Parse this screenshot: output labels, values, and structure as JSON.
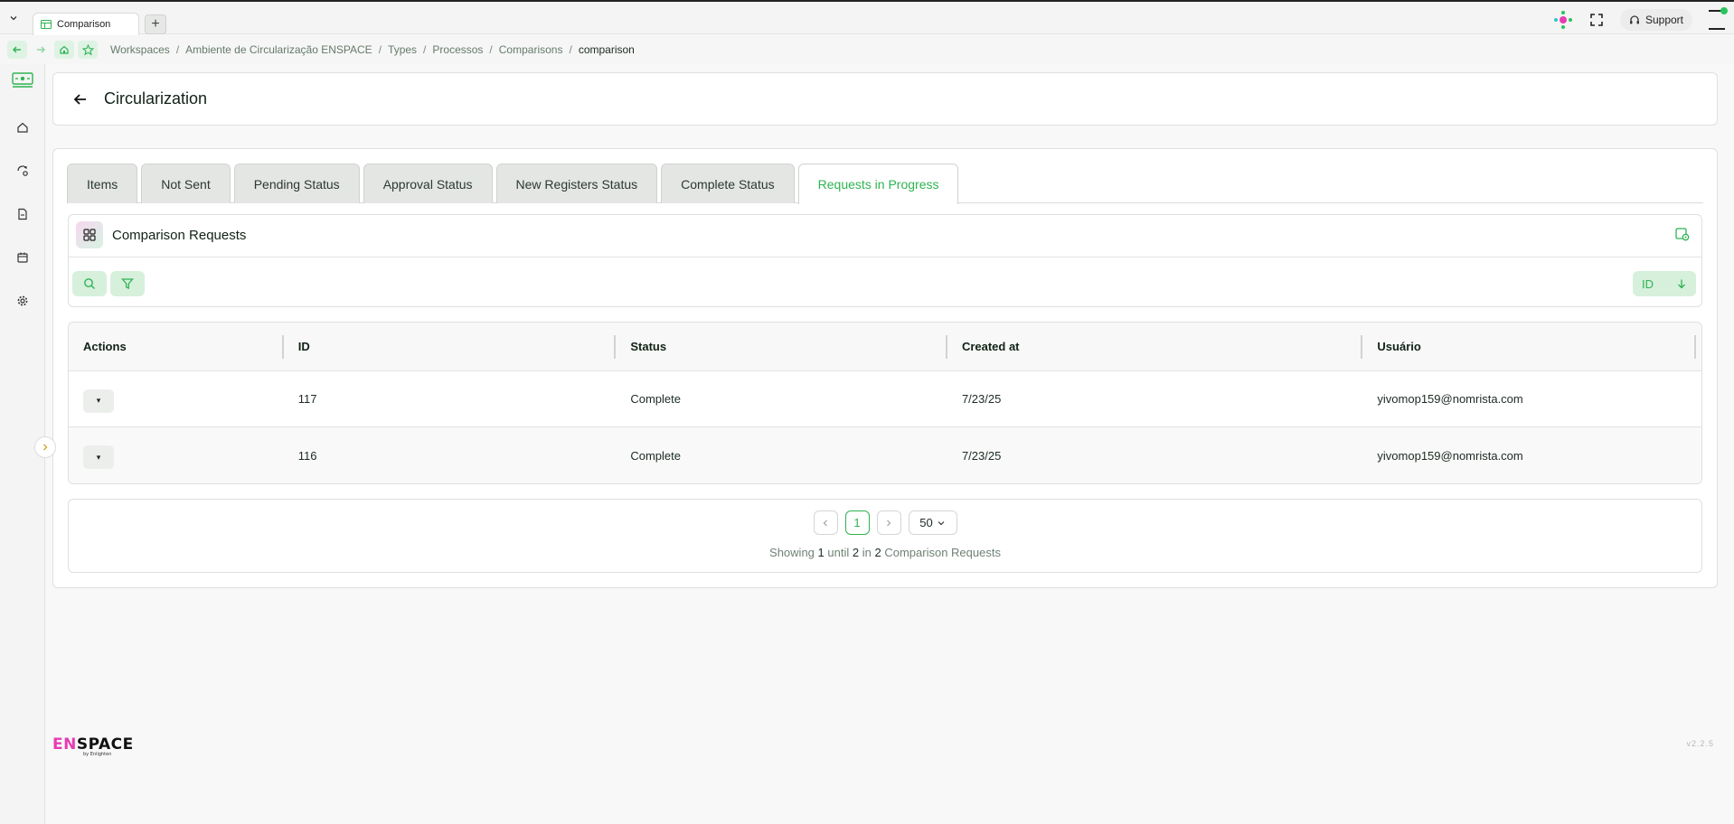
{
  "browser": {
    "tab_title": "Comparison",
    "new_tab": "+",
    "support_label": "Support"
  },
  "breadcrumb": [
    {
      "label": "Workspaces"
    },
    {
      "label": "Ambiente de Circularização ENSPACE"
    },
    {
      "label": "Types"
    },
    {
      "label": "Processos"
    },
    {
      "label": "Comparisons"
    },
    {
      "label": "comparison"
    }
  ],
  "breadcrumb_sep": "/",
  "page": {
    "title": "Circularization"
  },
  "tabs": [
    {
      "label": "Items",
      "active": false
    },
    {
      "label": "Not Sent",
      "active": false
    },
    {
      "label": "Pending Status",
      "active": false
    },
    {
      "label": "Approval Status",
      "active": false
    },
    {
      "label": "New Registers Status",
      "active": false
    },
    {
      "label": "Complete Status",
      "active": false
    },
    {
      "label": "Requests in Progress",
      "active": true
    }
  ],
  "panel": {
    "title": "Comparison Requests",
    "sort_field": "ID"
  },
  "table": {
    "columns": [
      "Actions",
      "ID",
      "Status",
      "Created at",
      "Usuário"
    ],
    "rows": [
      {
        "action": "▾",
        "id": "117",
        "status": "Complete",
        "created_at": "7/23/25",
        "user": "yivomop159@nomrista.com"
      },
      {
        "action": "▾",
        "id": "116",
        "status": "Complete",
        "created_at": "7/23/25",
        "user": "yivomop159@nomrista.com"
      }
    ]
  },
  "pagination": {
    "current_page": "1",
    "page_size": "50",
    "info_showing": "Showing",
    "info_from": "1",
    "info_until_word": "until",
    "info_to": "2",
    "info_in_word": "in",
    "info_total": "2",
    "info_entity": "Comparison Requests"
  },
  "footer": {
    "logo_en": "EN",
    "logo_space": "SPACE",
    "logo_sub": "by Enlighten",
    "version": "v2.2.5"
  },
  "colors": {
    "accent": "#2fb352",
    "accent_bg": "#d6f0dc",
    "logo_pink": "#e83bb4",
    "logo_cyan": "#2ec7c9"
  }
}
